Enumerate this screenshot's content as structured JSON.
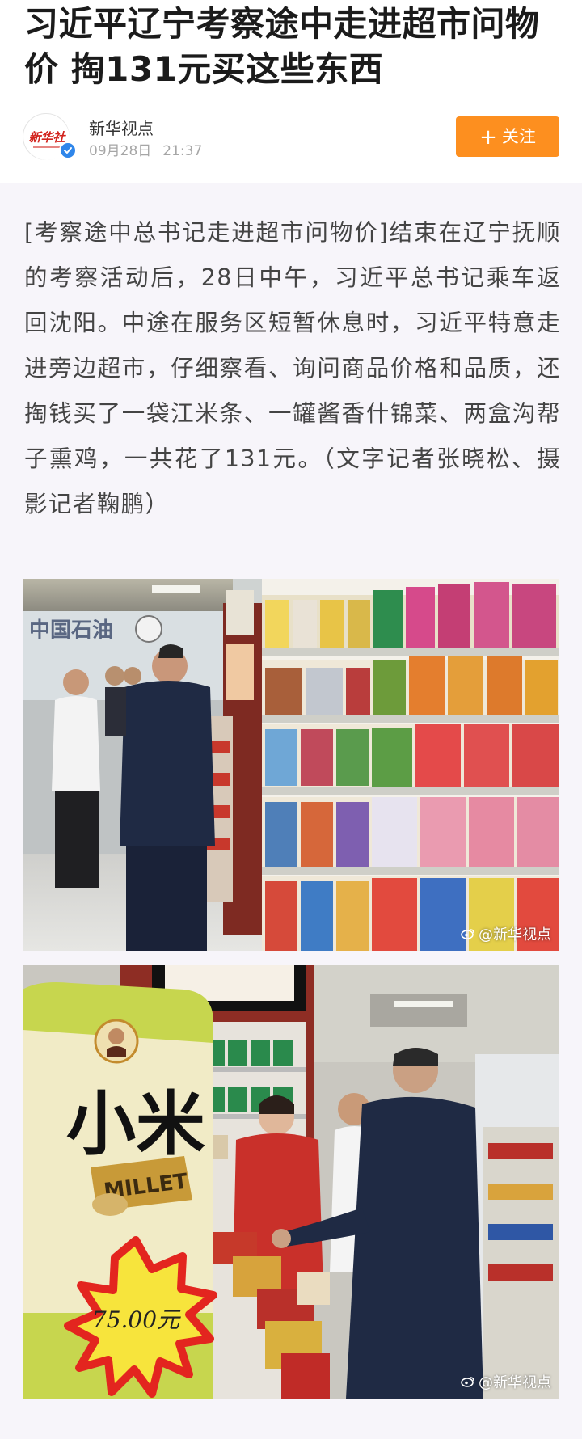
{
  "article": {
    "title": "习近平辽宁考察途中走进超市问物价 掏131元买这些东西",
    "author": {
      "name": "新华视点",
      "logo_text": "新华社",
      "date": "09月28日",
      "time": "21:37",
      "verified": true
    },
    "follow_button": {
      "icon": "plus-icon",
      "label": "关注"
    },
    "lead": "[考察途中总书记走进超市问物价]结束在辽宁抚顺的考察活动后，28日中午，习近平总书记乘车返回沈阳。中途在服务区短暂休息时，习近平特意走进旁边超市，仔细察看、询问商品价格和品质，还掏钱买了一袋江米条、一罐酱香什锦菜、两盒沟帮子熏鸡，一共花了131元。（文字记者张晓松、摄影记者鞠鹏）",
    "photos": [
      {
        "watermark": "@新华视点",
        "store_sign": "中国石油"
      },
      {
        "watermark": "@新华视点",
        "package_label": "小米",
        "package_sublabel": "MILLET",
        "price_tag": "75.00元"
      }
    ]
  },
  "colors": {
    "follow_button": "#fd8f1f",
    "verified_badge": "#2f86ea",
    "body_background": "#f7f5fa",
    "logo_red": "#d2231d"
  }
}
